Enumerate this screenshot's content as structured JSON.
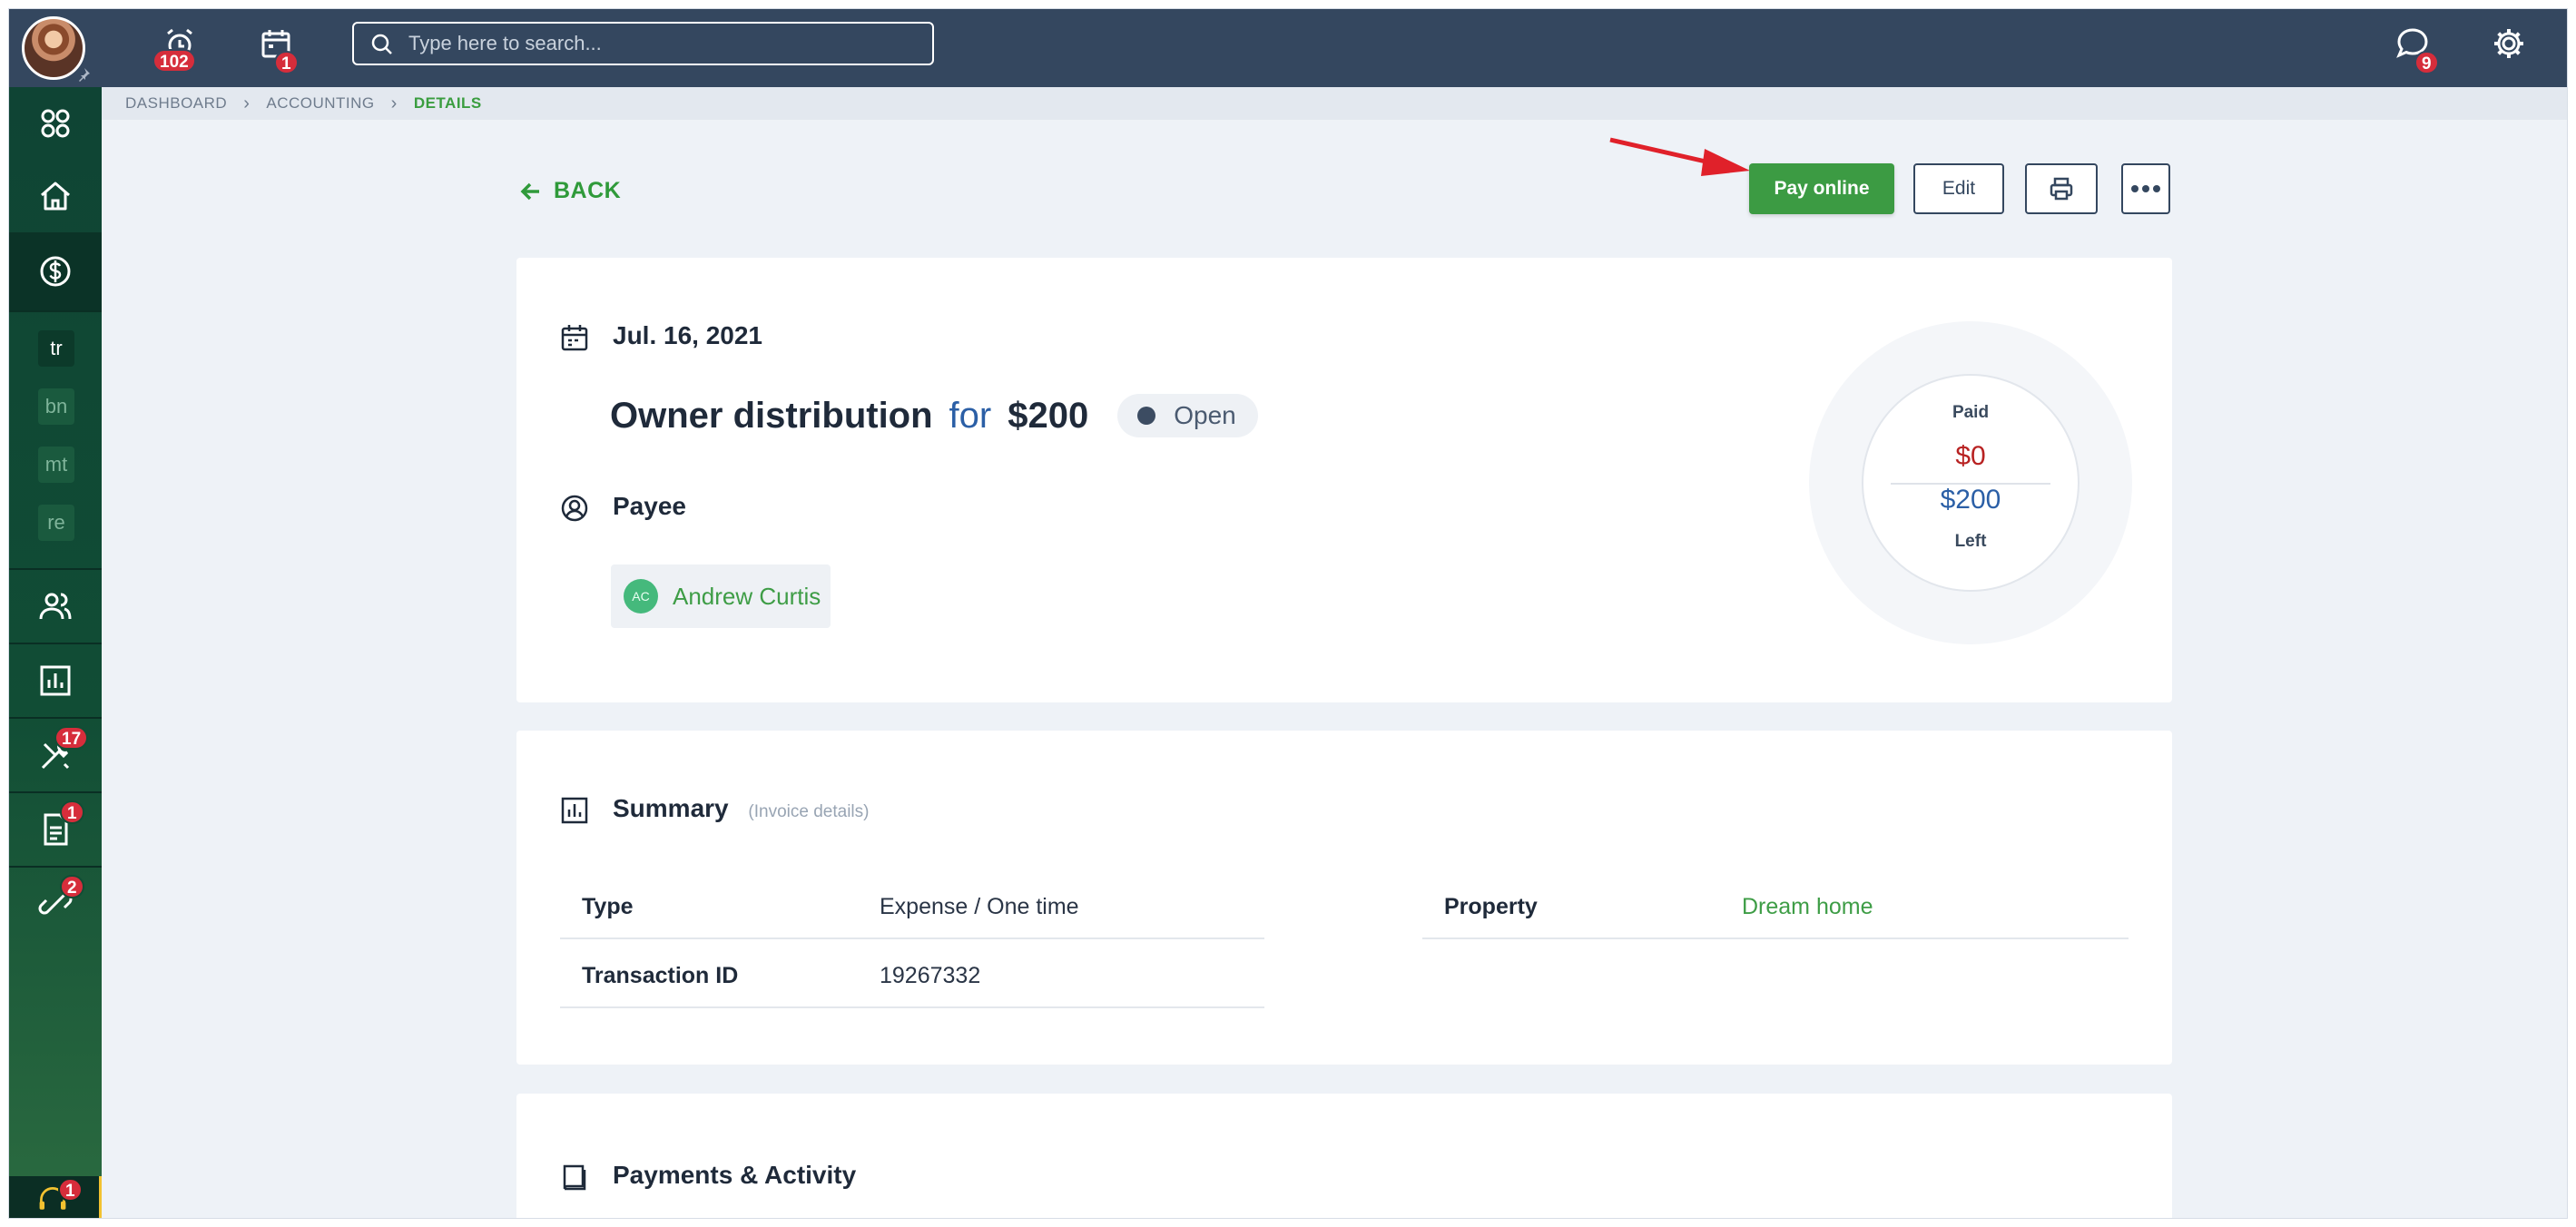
{
  "topbar": {
    "reminders_badge": "102",
    "calendar_badge": "1",
    "search_placeholder": "Type here to search...",
    "messages_badge": "9"
  },
  "breadcrumb": [
    "DASHBOARD",
    "ACCOUNTING",
    "DETAILS"
  ],
  "sidebar": {
    "shortcuts": [
      "tr",
      "bn",
      "mt",
      "re"
    ],
    "maintenance_badge": "17",
    "documents_badge": "1",
    "links_badge": "2",
    "support_badge": "1"
  },
  "actions": {
    "back_label": "BACK",
    "pay_online_label": "Pay online",
    "edit_label": "Edit"
  },
  "transaction": {
    "date": "Jul. 16, 2021",
    "title": "Owner distribution",
    "for_word": "for",
    "amount": "$200",
    "status": "Open",
    "payee_label": "Payee",
    "payee_initials": "AC",
    "payee_name": "Andrew Curtis"
  },
  "payment_status": {
    "paid_label": "Paid",
    "paid_amount": "$0",
    "left_amount": "$200",
    "left_label": "Left"
  },
  "summary": {
    "title": "Summary",
    "subtitle": "(Invoice details)",
    "left_rows": [
      {
        "key": "Type",
        "value": "Expense / One time"
      },
      {
        "key": "Transaction ID",
        "value": "19267332"
      }
    ],
    "right_rows": [
      {
        "key": "Property",
        "value": "Dream home"
      }
    ]
  },
  "payments": {
    "title": "Payments & Activity"
  },
  "colors": {
    "topbar": "#34475f",
    "sidebar": "#114d35",
    "accent_green": "#3c9b43",
    "link_blue": "#2b5fa6",
    "badge_red": "#d62d3b"
  }
}
